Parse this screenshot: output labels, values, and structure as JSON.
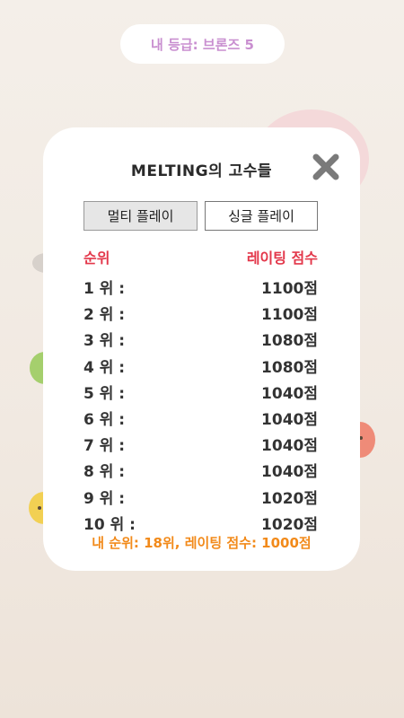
{
  "grade": {
    "text": "내 등급: 브론즈 5"
  },
  "modal": {
    "title": "MELTING의 고수들",
    "close_icon": "close-x-icon",
    "tabs": {
      "multi_label": "멀티 플레이",
      "single_label": "싱글 플레이",
      "active": "multi"
    },
    "headers": {
      "rank": "순위",
      "score": "레이팅 점수"
    },
    "rows": [
      {
        "rank": "1 위 :",
        "score": "1100점"
      },
      {
        "rank": "2 위 :",
        "score": "1100점"
      },
      {
        "rank": "3 위 :",
        "score": "1080점"
      },
      {
        "rank": "4 위 :",
        "score": "1080점"
      },
      {
        "rank": "5 위 :",
        "score": "1040점"
      },
      {
        "rank": "6 위 :",
        "score": "1040점"
      },
      {
        "rank": "7 위 :",
        "score": "1040점"
      },
      {
        "rank": "8 위 :",
        "score": "1040점"
      },
      {
        "rank": "9 위 :",
        "score": "1020점"
      },
      {
        "rank": "10 위 :",
        "score": "1020점"
      }
    ],
    "my_rank": "내 순위: 18위, 레이팅 점수: 1000점"
  },
  "colors": {
    "header": "#e3374a",
    "my_rank": "#f28a1a",
    "grade": "#c98fd0"
  }
}
